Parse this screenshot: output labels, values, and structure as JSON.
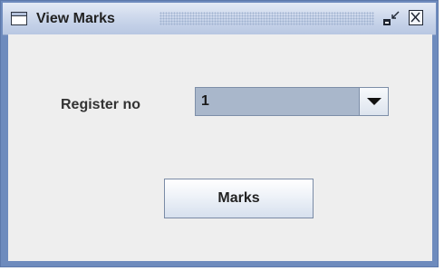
{
  "window": {
    "title": "View Marks"
  },
  "form": {
    "register_label": "Register no",
    "register_value": "1",
    "marks_button_label": "Marks"
  },
  "icons": {
    "window_icon": "window-icon",
    "iconify": "iconify-icon",
    "close": "close-icon",
    "dropdown": "chevron-down-icon"
  }
}
